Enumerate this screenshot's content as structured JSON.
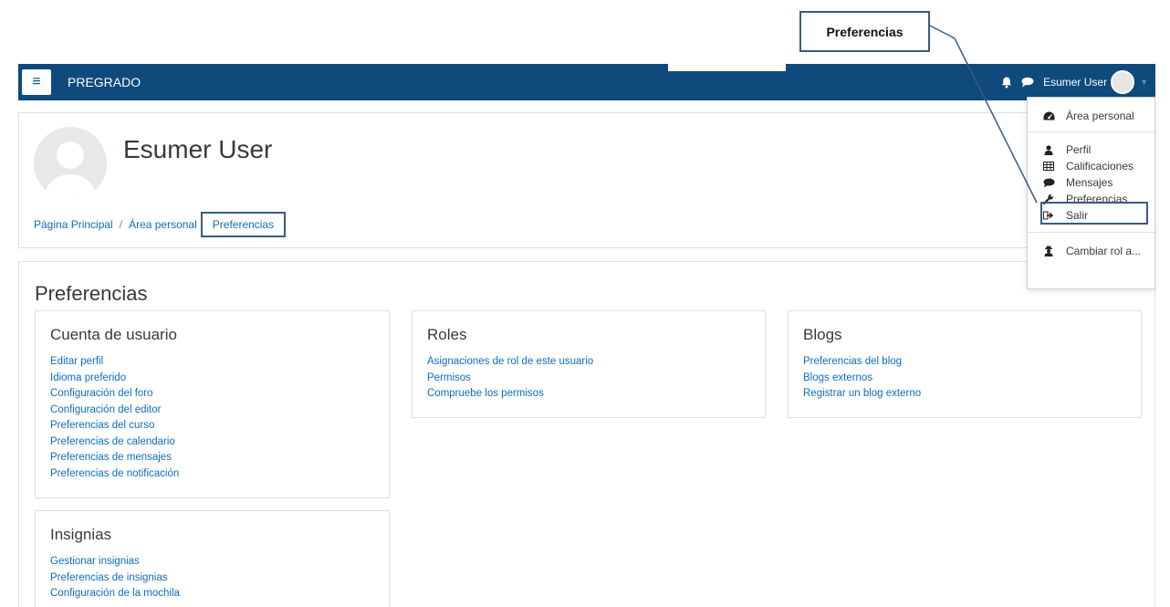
{
  "callout": {
    "label": "Preferencias"
  },
  "navbar": {
    "brand": "PREGRADO",
    "menu_icon": "hamburger-icon",
    "username": "Esumer User",
    "icons": [
      "bell-icon",
      "chat-icon",
      "avatar",
      "caret-down-icon"
    ]
  },
  "header": {
    "title": "Esumer User",
    "breadcrumb": [
      "Página Principal",
      "Área personal",
      "Preferencias"
    ]
  },
  "main": {
    "title": "Preferencias",
    "sections": [
      {
        "title": "Cuenta de usuario",
        "links": [
          "Editar perfil",
          "Idioma preferido",
          "Configuración del foro",
          "Configuración del editor",
          "Preferencias del curso",
          "Preferencias de calendario",
          "Preferencias de mensajes",
          "Preferencias de notificación"
        ]
      },
      {
        "title": "Roles",
        "links": [
          "Asignaciones de rol de este usuario",
          "Permisos",
          "Compruebe los permisos"
        ]
      },
      {
        "title": "Blogs",
        "links": [
          "Preferencias del blog",
          "Blogs externos",
          "Registrar un blog externo"
        ]
      },
      {
        "title": "Insignias",
        "links": [
          "Gestionar insignias",
          "Preferencias de insignias",
          "Configuración de la mochila"
        ]
      }
    ]
  },
  "dropdown": {
    "items": [
      {
        "label": "Área personal",
        "icon": "dashboard-icon"
      },
      {
        "label": "Perfil",
        "icon": "user-icon"
      },
      {
        "label": "Calificaciones",
        "icon": "table-icon"
      },
      {
        "label": "Mensajes",
        "icon": "chat-icon"
      },
      {
        "label": "Preferencias",
        "icon": "wrench-icon"
      },
      {
        "label": "Salir",
        "icon": "sign-out-icon"
      },
      {
        "label": "Cambiar rol a...",
        "icon": "user-secret-icon"
      }
    ]
  },
  "colors": {
    "navbar": "#0f4a7d",
    "link": "#0f6cbf",
    "annotation": "#3a5a82"
  }
}
